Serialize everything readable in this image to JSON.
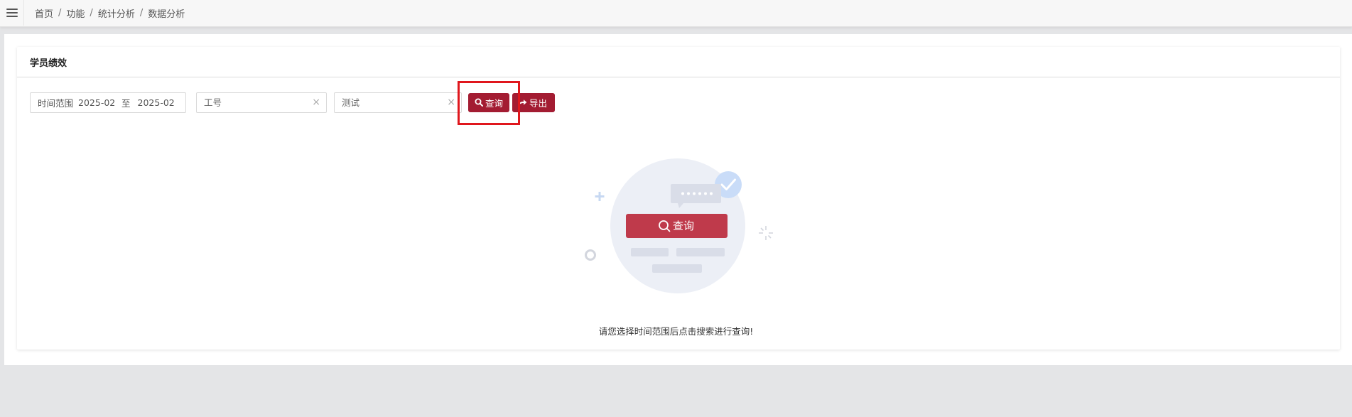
{
  "breadcrumb": [
    "首页",
    "功能",
    "统计分析",
    "数据分析"
  ],
  "breadcrumb_separator": "/",
  "card": {
    "title": "学员绩效"
  },
  "filters": {
    "date_range": {
      "label": "时间范围",
      "start": "2025-02",
      "separator": "至",
      "end": "2025-02"
    },
    "employee_id": {
      "placeholder": "工号",
      "value": ""
    },
    "name": {
      "placeholder": "测试",
      "value": ""
    },
    "clear_icon": "×"
  },
  "buttons": {
    "query": {
      "label": "查询",
      "icon": "search-icon"
    },
    "export": {
      "label": "导出",
      "icon": "share-icon"
    }
  },
  "empty_state": {
    "illustration_button_label": "查询",
    "message": "请您选择时间范围后点击搜索进行查询!"
  },
  "colors": {
    "accent": "#a31c32",
    "highlight_box": "#e0171d",
    "illustration_circle": "#eceff6",
    "illustration_check": "#c9dcf8"
  }
}
